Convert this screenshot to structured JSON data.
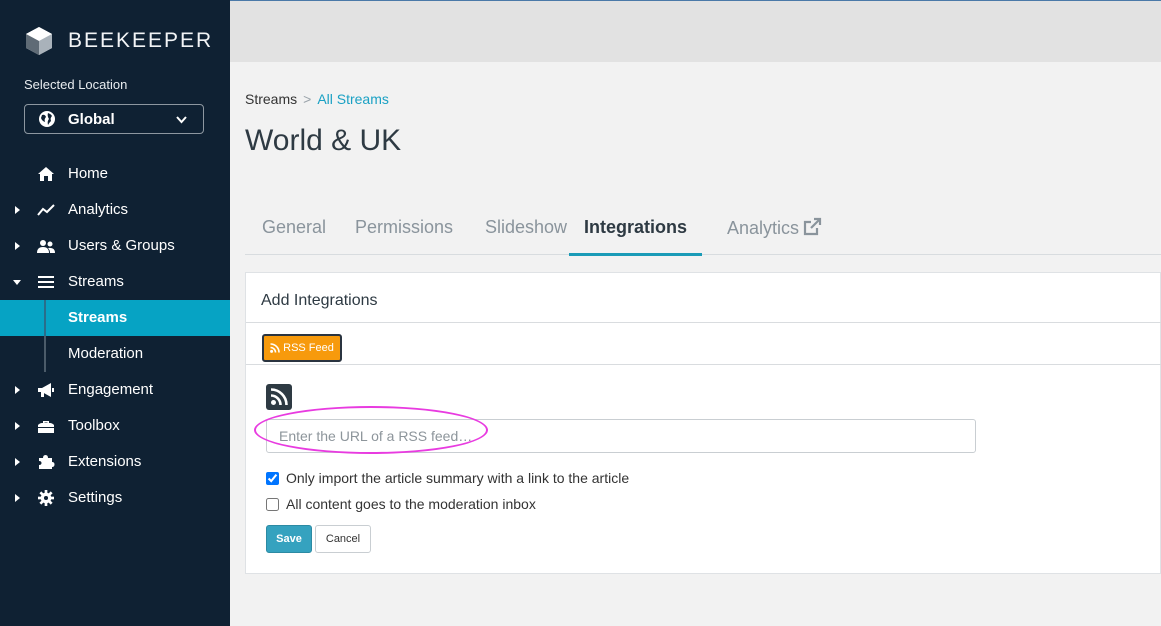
{
  "sidebar": {
    "brand": "BEEKEEPER",
    "location_label": "Selected Location",
    "location_value": "Global",
    "items": [
      {
        "label": "Home",
        "icon": "home-icon",
        "caret": false
      },
      {
        "label": "Analytics",
        "icon": "analytics-icon",
        "caret": true
      },
      {
        "label": "Users & Groups",
        "icon": "users-icon",
        "caret": true
      },
      {
        "label": "Streams",
        "icon": "list-icon",
        "caret": true,
        "expanded": true
      },
      {
        "label": "Engagement",
        "icon": "megaphone-icon",
        "caret": true
      },
      {
        "label": "Toolbox",
        "icon": "toolbox-icon",
        "caret": true
      },
      {
        "label": "Extensions",
        "icon": "puzzle-icon",
        "caret": true
      },
      {
        "label": "Settings",
        "icon": "gear-icon",
        "caret": true
      }
    ],
    "sub_items": [
      {
        "label": "Streams",
        "active": true
      },
      {
        "label": "Moderation",
        "active": false
      }
    ]
  },
  "breadcrumb": {
    "root": "Streams",
    "separator": ">",
    "current": "All Streams"
  },
  "page_title": "World & UK",
  "tabs": [
    {
      "label": "General",
      "active": false
    },
    {
      "label": "Permissions",
      "active": false
    },
    {
      "label": "Slideshow",
      "active": false
    },
    {
      "label": "Integrations",
      "active": true
    },
    {
      "label": "Analytics",
      "active": false,
      "external": true
    }
  ],
  "integrations": {
    "title": "Add Integrations",
    "rss_button": "RSS Feed",
    "url_placeholder": "Enter the URL of a RSS feed…",
    "url_value": "",
    "options": [
      {
        "label": "Only import the article summary with a link to the article",
        "checked": true
      },
      {
        "label": "All content goes to the moderation inbox",
        "checked": false
      }
    ],
    "save_label": "Save",
    "cancel_label": "Cancel"
  },
  "colors": {
    "sidebar_bg": "#0f2133",
    "active_item": "#06a3c4",
    "rss_orange": "#f79a0c",
    "save_button": "#35a2bf",
    "highlight_ring": "#e83be0"
  }
}
